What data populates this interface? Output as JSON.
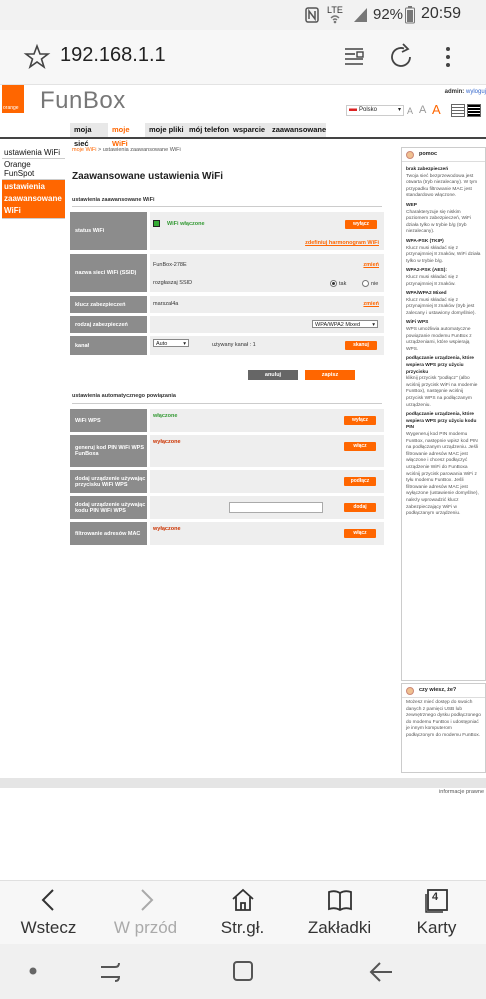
{
  "status_bar": {
    "battery": "92%",
    "time": "20:59",
    "network": "LTE"
  },
  "browser": {
    "url": "192.168.1.1"
  },
  "header": {
    "brand_small": "orange",
    "brand": "FunBox",
    "admin_label": "admin:",
    "logout": "wyloguj",
    "language": "Polsko",
    "font_sizes": [
      "A",
      "A",
      "A"
    ]
  },
  "nav": {
    "tabs": [
      "moja sieć",
      "moje WiFi",
      "moje pliki",
      "mój telefon",
      "wsparcie",
      "zaawansowane"
    ]
  },
  "sidebar": {
    "items": [
      "ustawienia WiFi",
      "Orange FunSpot",
      "ustawienia zaawansowane WiFi"
    ]
  },
  "breadcrumb": {
    "link": "moje WiFi",
    "sep": " > ",
    "current": "ustawienia zaawansowane WiFi"
  },
  "main": {
    "title": "Zaawansowane ustawienia WiFi",
    "section1": "ustawienia zaawansowane WiFi",
    "wifi_status": {
      "label": "status WiFi",
      "value": "WiFi włączone",
      "button": "wyłącz",
      "link": "zdefiniuj harmonogram WiFi"
    },
    "ssid": {
      "label": "nazwa sieci WiFi (SSID)",
      "value": "FunBox-278E",
      "change": "zmień",
      "broadcast_label": "rozgłaszaj SSID",
      "yes": "tak",
      "no": "nie"
    },
    "key": {
      "label": "klucz zabezpieczeń",
      "value": "marszal4a",
      "change": "zmień"
    },
    "security": {
      "label": "rodzaj zabezpieczeń",
      "value": "WPA/WPA2 Mixed"
    },
    "channel": {
      "label": "kanał",
      "value": "Auto",
      "used": "używany kanał : 1",
      "button": "skanuj"
    },
    "cancel": "anuluj",
    "save": "zapisz",
    "section2": "ustawienia automatycznego powiązania",
    "wps": {
      "label": "WiFi WPS",
      "value": "włączone",
      "button": "wyłącz"
    },
    "pin": {
      "label": "generuj kod PIN WiFi WPS FunBoxa",
      "value": "wyłączone",
      "button": "włącz"
    },
    "push": {
      "label": "dodaj urządzenie używając przycisku WiFi WPS",
      "button": "podłącz"
    },
    "pin_dev": {
      "label": "dodaj urządzenie używając kodu PIN WiFi WPS",
      "button": "dodaj"
    },
    "mac": {
      "label": "filtrowanie adresów MAC",
      "value": "wyłączone",
      "button": "włącz"
    }
  },
  "help": {
    "title": "pomoc",
    "sections": [
      {
        "head": "brak zabezpieczeń",
        "text": "Twoja sieć bezprzewodowa jest otwarta (tryb niezalecany). W tym przypadku filtrowanie MAC jest standardowo włączone."
      },
      {
        "head": "WEP",
        "text": "Charakteryzuje się niskim poziomem zabezpieczeń, WiFi działa tylko w trybie b/g (tryb niezalecany)."
      },
      {
        "head": "WPA-PSK (TKIP)",
        "text": "Klucz musi składać się z przynajmniej 8 znaków, WiFi działa tylko w trybie b/g."
      },
      {
        "head": "WPA2-PSK (AES):",
        "text": "Klucz musi składać się z przynajmniej 8 znaków."
      },
      {
        "head": "WPA/WPA2 Mixed",
        "text": "Klucz musi składać się z przynajmniej 8 znaków (tryb jest zalecany i ustawiony domyślnie)."
      },
      {
        "head": "WiFi WPS",
        "text": "WPS umożliwia automatyczne powiązanie modemu FunBox z urządzeniami, które wspierają WPS."
      },
      {
        "head": "podłączanie urządzenia, które wspiera WPS przy użyciu przycisku",
        "text": "kliknij przycisk \"podłącz\" (albo wciśnij przycisk WiFi na modemie FunBox), następnie wciśnij przycisk WPS na podłączanym urządzeniu."
      },
      {
        "head": "podłączanie urządzenia, które wspiera WPS przy użyciu kodu PIN",
        "text": "Wygeneruj kod PIN modemu FunBox, następnie wpisz kod PIN na podłączanym urządzeniu. Jeśli filtrowanie adresów MAC jest włączone i chcesz podłączyć urządzenie WiFi do FunBoxa wciśnij przycisk parowania WiFi z tyłu modemu FunBox. Jeśli filtrowanie adresów MAC jest wyłączone (ustawienie domyślne), należy wprowadzić klucz zabezpieczający WiFi w podłączanym urządzeniu."
      }
    ],
    "tip_title": "czy wiesz, że?",
    "tip_text": "Możesz mieć dostęp do swoich danych z pamięci USB lub zewnętrznego dysku podłączonego do modemu FunBox i udostępniać je innym komputerom podłączonym do modemu FunBox."
  },
  "footer": {
    "legal": "informacje prawne"
  },
  "bottom_toolbar": {
    "back": "Wstecz",
    "forward": "W przód",
    "home": "Str.gł.",
    "bookmarks": "Zakładki",
    "tabs": "Karty",
    "tab_count": "4"
  }
}
